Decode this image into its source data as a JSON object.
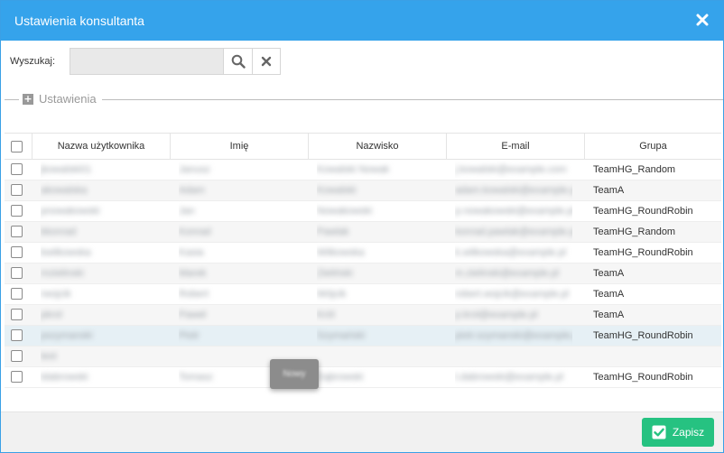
{
  "dialog": {
    "title": "Ustawienia konsultanta",
    "close_icon": "close-icon"
  },
  "search": {
    "label": "Wyszukaj:",
    "value": "",
    "placeholder": "",
    "search_icon": "search-icon",
    "clear_icon": "clear-icon"
  },
  "settings_section": {
    "label": "Ustawienia",
    "icon": "plus-square-icon"
  },
  "table": {
    "columns": [
      "Nazwa użytkownika",
      "Imię",
      "Nazwisko",
      "E-mail",
      "Grupa"
    ],
    "rows": [
      {
        "username": "jkowalski01",
        "first": "Janusz",
        "last": "Kowalski Nowak",
        "email": "j.kowalski@example.com",
        "group": "TeamHG_Random"
      },
      {
        "username": "akowalska",
        "first": "Adam",
        "last": "Kowalski",
        "email": "adam.kowalski@example.pl",
        "group": "TeamA"
      },
      {
        "username": "pnowakowski",
        "first": "Jan",
        "last": "Nowakowski",
        "email": "p.nowakowski@example.pl",
        "group": "TeamHG_RoundRobin"
      },
      {
        "username": "kkonrad",
        "first": "Konrad",
        "last": "Pawlak",
        "email": "konrad.pawlak@example.pl",
        "group": "TeamHG_Random"
      },
      {
        "username": "kwitkowska",
        "first": "Kasia",
        "last": "Witkowska",
        "email": "k.witkowska@example.pl",
        "group": "TeamHG_RoundRobin"
      },
      {
        "username": "mzielinski",
        "first": "Marek",
        "last": "Zieliński",
        "email": "m.zielinski@example.pl",
        "group": "TeamA"
      },
      {
        "username": "rwojcik",
        "first": "Robert",
        "last": "Wójcik",
        "email": "robert.wojcik@example.pl",
        "group": "TeamA"
      },
      {
        "username": "pkrol",
        "first": "Paweł",
        "last": "Król",
        "email": "p.krol@example.pl",
        "group": "TeamA"
      },
      {
        "username": "pszymanski",
        "first": "Piotr",
        "last": "Szymański",
        "email": "piotr.szymanski@example.pl",
        "group": "TeamHG_RoundRobin"
      },
      {
        "username": "test",
        "first": "",
        "last": "",
        "email": "",
        "group": ""
      },
      {
        "username": "tdabrowski",
        "first": "Tomasz",
        "last": "Dąbrowski",
        "email": "t.dabrowski@example.pl",
        "group": "TeamHG_RoundRobin"
      }
    ]
  },
  "tooltip": {
    "text": "Nowy"
  },
  "footer": {
    "save_label": "Zapisz",
    "save_icon": "check-square-icon"
  },
  "colors": {
    "titlebar": "#35a3eb",
    "save_button": "#26c281",
    "selected_row": "#e6f0f5"
  }
}
